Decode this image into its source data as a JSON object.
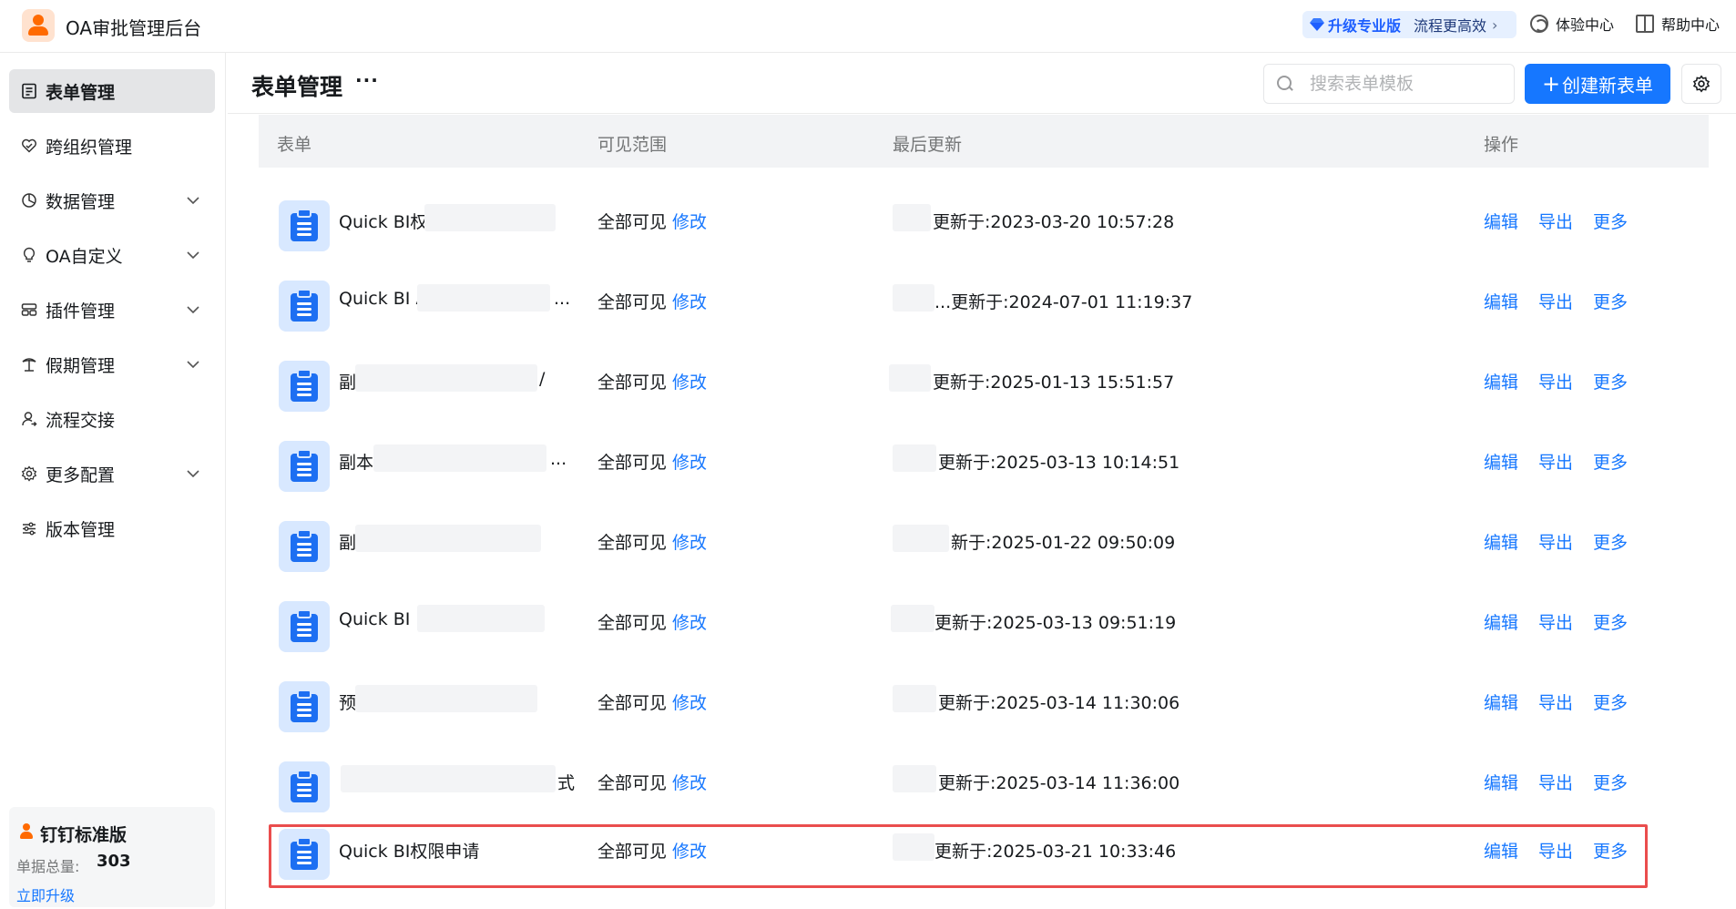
{
  "app": {
    "title": "OA审批管理后台"
  },
  "topbar": {
    "upgrade_pro": "升级专业版",
    "upgrade_slogan": "流程更高效",
    "upgrade_chevron": "›",
    "experience_center": "体验中心",
    "help_center": "帮助中心"
  },
  "sidebar": {
    "items": [
      {
        "label": "表单管理",
        "icon": "form-icon",
        "active": true,
        "expandable": false
      },
      {
        "label": "跨组织管理",
        "icon": "heart-link-icon",
        "active": false,
        "expandable": false
      },
      {
        "label": "数据管理",
        "icon": "pie-chart-icon",
        "active": false,
        "expandable": true
      },
      {
        "label": "OA自定义",
        "icon": "bulb-icon",
        "active": false,
        "expandable": true
      },
      {
        "label": "插件管理",
        "icon": "plugin-icon",
        "active": false,
        "expandable": true
      },
      {
        "label": "假期管理",
        "icon": "palm-tree-icon",
        "active": false,
        "expandable": true
      },
      {
        "label": "流程交接",
        "icon": "user-transfer-icon",
        "active": false,
        "expandable": false
      },
      {
        "label": "更多配置",
        "icon": "gear-icon",
        "active": false,
        "expandable": true
      },
      {
        "label": "版本管理",
        "icon": "sliders-icon",
        "active": false,
        "expandable": false
      }
    ],
    "edition": {
      "title": "钉钉标准版",
      "count_label": "单据总量:",
      "count": "303",
      "upgrade_link": "立即升级"
    }
  },
  "header": {
    "title": "表单管理",
    "more": "···",
    "search_placeholder": "搜索表单模板",
    "create_button": "创建新表单",
    "create_plus": "+"
  },
  "table": {
    "columns": {
      "form": "表单",
      "scope": "可见范围",
      "updated": "最后更新",
      "actions": "操作"
    },
    "rows": [
      {
        "name": "Quick BI权",
        "scope": "全部可见",
        "scope_edit": "修改",
        "updated": "更新于:2023-03-20 10:57:28",
        "edit": "编辑",
        "export": "导出",
        "more": "更多",
        "highlight": false
      },
      {
        "name": "Quick BI A",
        "name_tail": "...",
        "scope": "全部可见",
        "scope_edit": "修改",
        "updated": "...更新于:2024-07-01 11:19:37",
        "edit": "编辑",
        "export": "导出",
        "more": "更多",
        "highlight": false
      },
      {
        "name": "副",
        "name_tail": "/",
        "scope": "全部可见",
        "scope_edit": "修改",
        "updated": "更新于:2025-01-13 15:51:57",
        "edit": "编辑",
        "export": "导出",
        "more": "更多",
        "highlight": false
      },
      {
        "name": "副本",
        "name_tail": "...",
        "scope": "全部可见",
        "scope_edit": "修改",
        "updated": "更新于:2025-03-13 10:14:51",
        "edit": "编辑",
        "export": "导出",
        "more": "更多",
        "highlight": false
      },
      {
        "name": "副",
        "name_tail": "",
        "scope": "全部可见",
        "scope_edit": "修改",
        "updated": "新于:2025-01-22 09:50:09",
        "edit": "编辑",
        "export": "导出",
        "more": "更多",
        "highlight": false
      },
      {
        "name": "Quick BI",
        "name_tail": "",
        "scope": "全部可见",
        "scope_edit": "修改",
        "updated": "更新于:2025-03-13 09:51:19",
        "edit": "编辑",
        "export": "导出",
        "more": "更多",
        "highlight": false
      },
      {
        "name": "预",
        "name_tail": "",
        "scope": "全部可见",
        "scope_edit": "修改",
        "updated": "更新于:2025-03-14 11:30:06",
        "edit": "编辑",
        "export": "导出",
        "more": "更多",
        "highlight": false
      },
      {
        "name": "",
        "name_tail": "式",
        "scope": "全部可见",
        "scope_edit": "修改",
        "updated": "更新于:2025-03-14 11:36:00",
        "edit": "编辑",
        "export": "导出",
        "more": "更多",
        "highlight": false
      },
      {
        "name": "Quick BI权限申请",
        "name_tail": "",
        "scope": "全部可见",
        "scope_edit": "修改",
        "updated": "更新于:2025-03-21 10:33:46",
        "edit": "编辑",
        "export": "导出",
        "more": "更多",
        "highlight": true
      }
    ]
  },
  "colors": {
    "accent": "#1677ff",
    "highlight": "#ea4d4d",
    "active_nav": "#e4e5e7",
    "header_bg": "#f2f3f5"
  }
}
